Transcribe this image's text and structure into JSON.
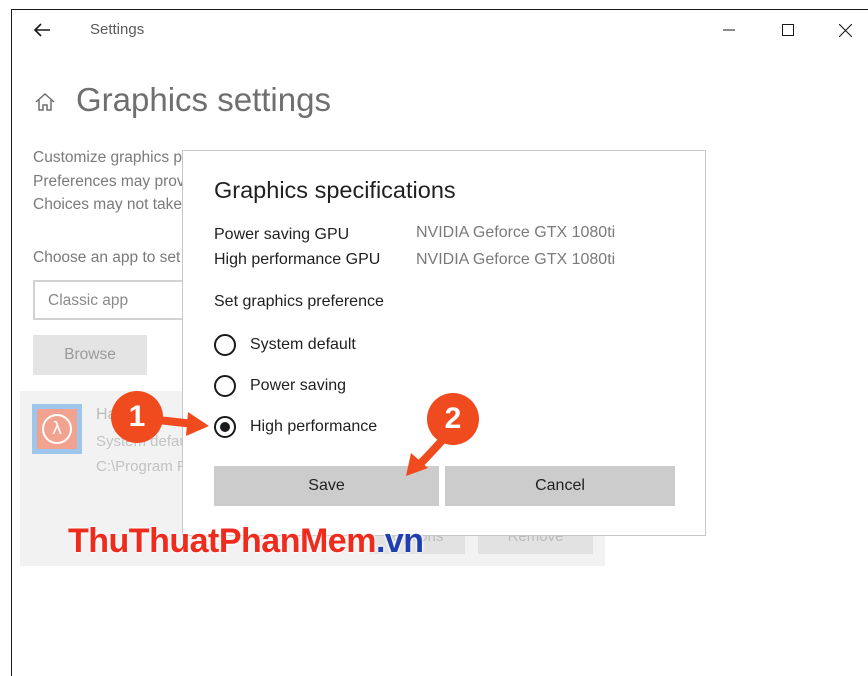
{
  "window": {
    "title": "Settings",
    "back_icon": "back-arrow-icon",
    "controls": [
      "minimize-icon",
      "maximize-icon",
      "close-icon"
    ]
  },
  "page": {
    "home_icon": "home-icon",
    "title": "Graphics settings",
    "description_lines": [
      "Customize graphics performance preference for specific applications.",
      "Preferences may provide better app performance or save battery life.",
      "Choices may not take effect until the next time the app launches."
    ],
    "choose_label": "Choose an app to set preference",
    "app_type_select": "Classic app",
    "browse_label": "Browse"
  },
  "app_card": {
    "name": "Half-Life",
    "preference": "System default",
    "path": "C:\\Program Files",
    "options_label": "Options",
    "remove_label": "Remove"
  },
  "dialog": {
    "title": "Graphics specifications",
    "specs": [
      {
        "label": "Power saving GPU",
        "value": "NVIDIA Geforce GTX 1080ti"
      },
      {
        "label": "High performance GPU",
        "value": "NVIDIA Geforce GTX 1080ti"
      }
    ],
    "preference_heading": "Set graphics preference",
    "options": [
      {
        "label": "System default",
        "checked": false
      },
      {
        "label": "Power saving",
        "checked": false
      },
      {
        "label": "High performance",
        "checked": true
      }
    ],
    "save_label": "Save",
    "cancel_label": "Cancel"
  },
  "annotations": {
    "step1": "1",
    "step2": "2",
    "accent_color": "#f04a1f"
  },
  "watermark": {
    "part1": "ThuThuat",
    "part2": "PhanMem",
    "part3": ".vn"
  }
}
